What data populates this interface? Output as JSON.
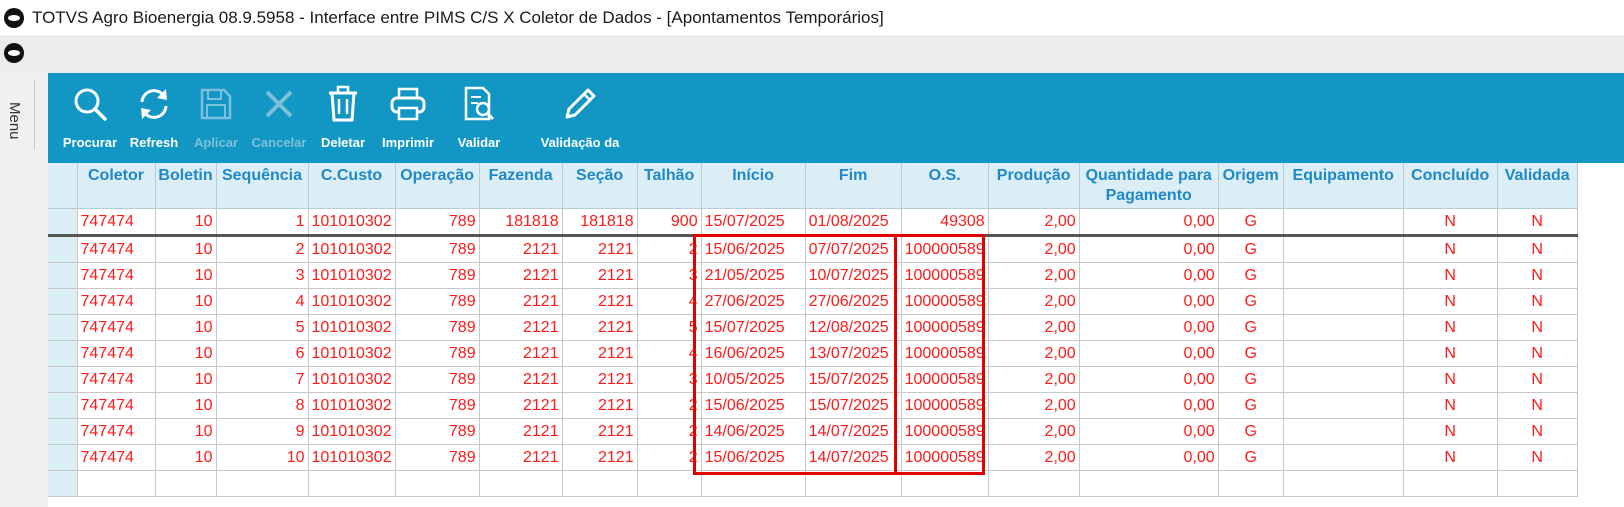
{
  "window": {
    "title": "TOTVS Agro Bioenergia 08.9.5958 - Interface entre PIMS C/S X Coletor de Dados - [Apontamentos Temporários]"
  },
  "sidebar": {
    "menu_label": "Menu"
  },
  "toolbar": {
    "buttons": [
      {
        "label": "Procurar",
        "icon": "search-icon",
        "enabled": true
      },
      {
        "label": "Refresh",
        "icon": "refresh-icon",
        "enabled": true
      },
      {
        "label": "Aplicar",
        "icon": "save-icon",
        "enabled": false
      },
      {
        "label": "Cancelar",
        "icon": "close-icon",
        "enabled": false
      },
      {
        "label": "Deletar",
        "icon": "trash-icon",
        "enabled": true
      },
      {
        "label": "Imprimir",
        "icon": "printer-icon",
        "enabled": true
      },
      {
        "label": "Validar",
        "icon": "validate-document-icon",
        "enabled": true
      },
      {
        "label": "Validação da",
        "icon": "pencil-icon",
        "enabled": true
      }
    ]
  },
  "grid": {
    "columns": [
      "Coletor",
      "Boletin",
      "Sequência",
      "C.Custo",
      "Operação",
      "Fazenda",
      "Seção",
      "Talhão",
      "Início",
      "Fim",
      "O.S.",
      "Produção",
      "Quantidade para Pagamento",
      "Origem",
      "Equipamento",
      "Concluído",
      "Validada"
    ],
    "rows": [
      [
        "747474",
        "10",
        "1",
        "101010302",
        "789",
        "181818",
        "181818",
        "900",
        "15/07/2025",
        "01/08/2025",
        "49308",
        "2,00",
        "0,00",
        "G",
        "",
        "N",
        "N"
      ],
      [
        "747474",
        "10",
        "2",
        "101010302",
        "789",
        "2121",
        "2121",
        "2",
        "15/06/2025",
        "07/07/2025",
        "100000589",
        "2,00",
        "0,00",
        "G",
        "",
        "N",
        "N"
      ],
      [
        "747474",
        "10",
        "3",
        "101010302",
        "789",
        "2121",
        "2121",
        "3",
        "21/05/2025",
        "10/07/2025",
        "100000589",
        "2,00",
        "0,00",
        "G",
        "",
        "N",
        "N"
      ],
      [
        "747474",
        "10",
        "4",
        "101010302",
        "789",
        "2121",
        "2121",
        "4",
        "27/06/2025",
        "27/06/2025",
        "100000589",
        "2,00",
        "0,00",
        "G",
        "",
        "N",
        "N"
      ],
      [
        "747474",
        "10",
        "5",
        "101010302",
        "789",
        "2121",
        "2121",
        "5",
        "15/07/2025",
        "12/08/2025",
        "100000589",
        "2,00",
        "0,00",
        "G",
        "",
        "N",
        "N"
      ],
      [
        "747474",
        "10",
        "6",
        "101010302",
        "789",
        "2121",
        "2121",
        "4",
        "16/06/2025",
        "13/07/2025",
        "100000589",
        "2,00",
        "0,00",
        "G",
        "",
        "N",
        "N"
      ],
      [
        "747474",
        "10",
        "7",
        "101010302",
        "789",
        "2121",
        "2121",
        "3",
        "10/05/2025",
        "15/07/2025",
        "100000589",
        "2,00",
        "0,00",
        "G",
        "",
        "N",
        "N"
      ],
      [
        "747474",
        "10",
        "8",
        "101010302",
        "789",
        "2121",
        "2121",
        "2",
        "15/06/2025",
        "15/07/2025",
        "100000589",
        "2,00",
        "0,00",
        "G",
        "",
        "N",
        "N"
      ],
      [
        "747474",
        "10",
        "9",
        "101010302",
        "789",
        "2121",
        "2121",
        "2",
        "14/06/2025",
        "14/07/2025",
        "100000589",
        "2,00",
        "0,00",
        "G",
        "",
        "N",
        "N"
      ],
      [
        "747474",
        "10",
        "10",
        "101010302",
        "789",
        "2121",
        "2121",
        "2",
        "15/06/2025",
        "14/07/2025",
        "100000589",
        "2,00",
        "0,00",
        "G",
        "",
        "N",
        "N"
      ]
    ]
  },
  "colors": {
    "toolbar_bg": "#1296c4",
    "header_text": "#1e88c8",
    "row_text": "#ff1a1a",
    "highlight": "#e00000"
  }
}
